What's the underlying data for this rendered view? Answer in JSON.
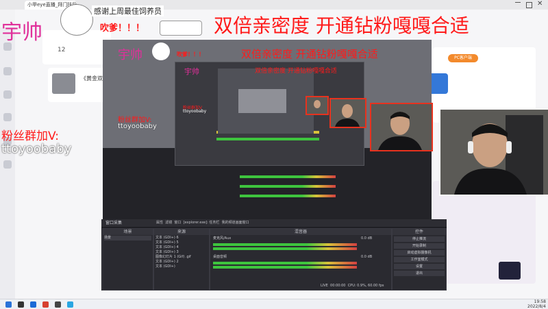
{
  "browser": {
    "tab_title": "小甲eye直播_拜门扶后直播",
    "counter": "12",
    "side_text": "《黄金双",
    "side_text_2": "《黄金双",
    "badge_label": "PC客户端"
  },
  "overlay": {
    "name_large": "宇帅",
    "name_mid": "宇帅",
    "name_small": "宇帅",
    "thanks_label": "感谢上周最佳饲养员",
    "gift_label": "吹爹！！！",
    "slogan": "双倍亲密度 开通钻粉嘎嘎合适",
    "fan_group_line": "粉丝群加V:",
    "fan_group_id": "ttoyoobaby",
    "fan_group_line_small": "粉丝群加V:",
    "fan_group_id_small": "ttoyoobaby",
    "fan_group_line_tiny": "粉丝群加V",
    "fan_group_id_tiny": "ttoyoobaby"
  },
  "obs": {
    "window_title": "窗口采集",
    "toolbar_items": [
      "属性",
      "滤镜",
      "窗口",
      "[explorer.exe]: 任务栏",
      "我的频道画面窗口"
    ],
    "docks": {
      "scenes": {
        "title": "场景",
        "items": [
          "场景"
        ]
      },
      "sources": {
        "title": "来源",
        "items": [
          "文本 (GDI+) 6",
          "文本 (GDI+) 5",
          "文本 (GDI+) 4",
          "文本 (GDI+) 3",
          "图像幻灯片 1 (Gif) .gif",
          "文本 (GDI+) 2",
          "文本 (GDI+)"
        ]
      },
      "mixer": {
        "title": "混音器",
        "channels": [
          {
            "name": "麦克风/Aux",
            "db": "0.0 dB"
          },
          {
            "name": "桌面音频",
            "db": "0.0 dB"
          }
        ]
      },
      "controls": {
        "title": "控件",
        "buttons": [
          "停止推流",
          "开始录制",
          "启动虚拟摄像机",
          "工作室模式",
          "设置",
          "退出"
        ]
      }
    },
    "status": {
      "fps_label": "60fps",
      "bitrate_label": "LIVE",
      "cpu": "CPU: 0.9%, 60.00 fps",
      "time": "00:00:00"
    }
  },
  "taskbar": {
    "time": "19:58",
    "date": "2022/8/4"
  },
  "colors": {
    "accent_red": "#ff1a1a",
    "camera_border": "#e8321e",
    "meter_green": "#3ec43e",
    "obs_bg": "#1f1f24"
  }
}
